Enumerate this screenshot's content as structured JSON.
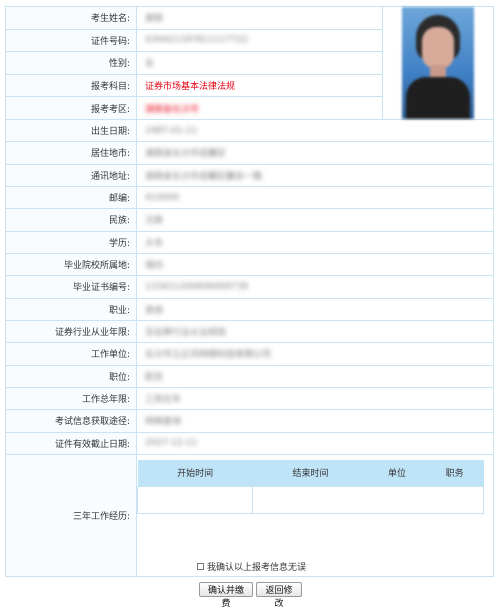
{
  "form": {
    "fields": [
      {
        "label": "考生姓名:",
        "value": "谢丽",
        "obscured": true
      },
      {
        "label": "证件号码:",
        "value": "430421197811117722",
        "obscured": true
      },
      {
        "label": "性别:",
        "value": "女",
        "obscured": true
      },
      {
        "label": "报考科目:",
        "value": "证券市场基本法律法规",
        "obscured": false,
        "color": "#e60012"
      },
      {
        "label": "报考考区:",
        "value": "湖南省长沙市",
        "obscured": true,
        "color": "#e60012"
      },
      {
        "label": "出生日期:",
        "value": "1987-01-11",
        "obscured": true
      },
      {
        "label": "居住地市:",
        "value": "湖南省长沙市岳麓区",
        "obscured": true
      },
      {
        "label": "通讯地址:",
        "value": "湖南省长沙市岳麓区麓谷一路",
        "obscured": true
      },
      {
        "label": "邮编:",
        "value": "410000",
        "obscured": true
      },
      {
        "label": "民族:",
        "value": "汉族",
        "obscured": true
      },
      {
        "label": "学历:",
        "value": "大专",
        "obscured": true
      },
      {
        "label": "毕业院校所属地:",
        "value": "境内",
        "obscured": true
      },
      {
        "label": "毕业证书编号:",
        "value": "133411200606009739",
        "obscured": true
      },
      {
        "label": "职业:",
        "value": "其他",
        "obscured": true
      },
      {
        "label": "证券行业从业年限:",
        "value": "无证券行业从业经验",
        "obscured": true
      },
      {
        "label": "工作单位:",
        "value": "长沙市立正风网络科技有限公司",
        "obscured": true
      },
      {
        "label": "职位:",
        "value": "职员",
        "obscured": true
      },
      {
        "label": "工作总年限:",
        "value": "三到五年",
        "obscured": true
      },
      {
        "label": "考试信息获取途径:",
        "value": "网络查询",
        "obscured": true
      },
      {
        "label": "证件有效截止日期:",
        "value": "2027-12-11",
        "obscured": true
      }
    ],
    "work_history": {
      "label": "三年工作经历:",
      "columns": [
        "开始时间",
        "结束时间",
        "单位",
        "职务"
      ]
    }
  },
  "confirm_label": "我确认以上报考信息无误",
  "buttons": {
    "submit_label": "确认并缴费",
    "back_label": "返回修改"
  },
  "colors": {
    "border": "#c9e3f2",
    "header_bg": "#bfe4f8",
    "accent_red": "#e60012"
  },
  "photo": {
    "icon": "applicant-photo",
    "obscured": true
  }
}
